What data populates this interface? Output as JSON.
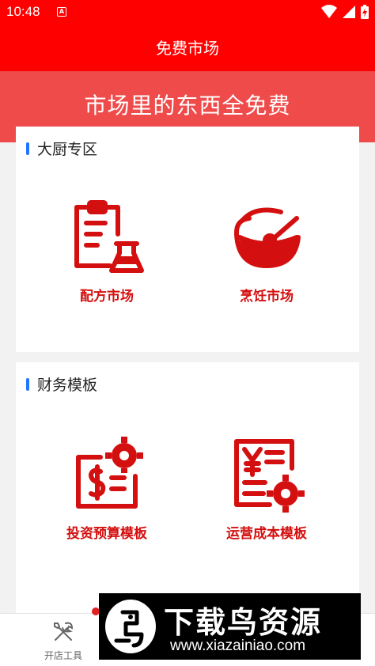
{
  "status_bar": {
    "time": "10:48",
    "notification_glyph": "A",
    "icons": [
      "wifi-icon",
      "signal-icon",
      "battery-icon"
    ]
  },
  "app_bar": {
    "title": "免费市场"
  },
  "banner": {
    "text": "市场里的东西全免费"
  },
  "sections": [
    {
      "title": "大厨专区",
      "items": [
        {
          "label": "配方市场",
          "icon": "clipboard-flask-icon"
        },
        {
          "label": "烹饪市场",
          "icon": "bowl-spoon-icon"
        }
      ]
    },
    {
      "title": "财务模板",
      "items": [
        {
          "label": "投资预算模板",
          "icon": "money-gear-icon"
        },
        {
          "label": "运营成本模板",
          "icon": "yen-document-gear-icon"
        }
      ]
    }
  ],
  "bottom_nav": {
    "tabs": [
      {
        "label": "开店工具",
        "icon": "tools-icon"
      }
    ]
  },
  "watermark": {
    "title": "下载鸟资源",
    "url": "www.xiazainiao.com"
  },
  "colors": {
    "primary": "#ff0000",
    "banner": "#ef4b4b",
    "icon_red": "#d40f0f",
    "section_marker": "#2176ff"
  }
}
